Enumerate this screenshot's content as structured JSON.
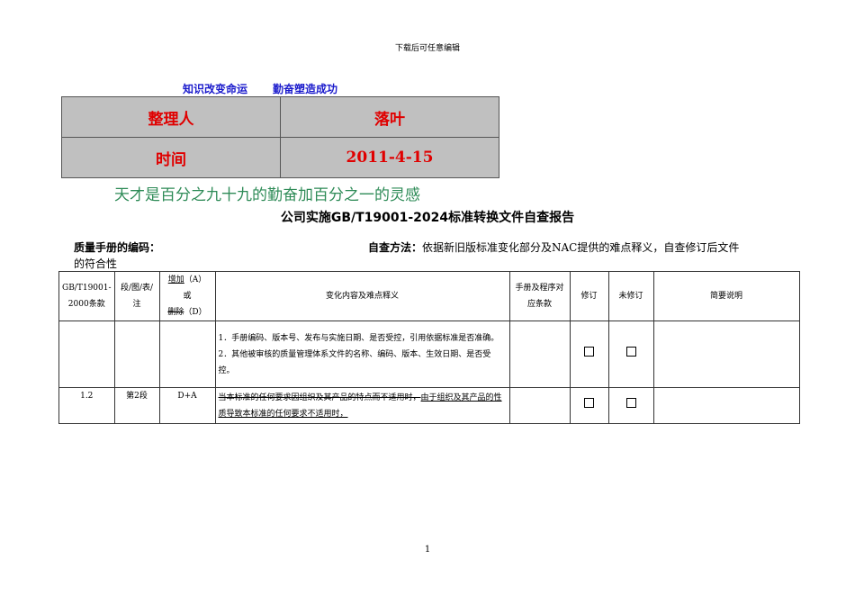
{
  "header": "下载后可任意编辑",
  "motto": [
    "知识改变命运",
    "勤奋塑造成功"
  ],
  "info": [
    {
      "label": "整理人",
      "value": "落叶"
    },
    {
      "label": "时间",
      "value": "2011-4-15"
    }
  ],
  "quote": "天才是百分之九十九的勤奋加百分之一的灵感",
  "title": "公司实施GB/T19001-2024标准转换文件自查报告",
  "code_label": "质量手册的编码：",
  "method_label": "自查方法：",
  "method_text": "依据新旧版标准变化部分及NAC提供的难点释义，自查修订后文件",
  "method_tail": "的符合性",
  "table": {
    "headers": {
      "clause": "GB/T19001-2000条款",
      "para": "段/图/表/注",
      "add": "增加",
      "add_code": "（A）",
      "or": "或",
      "del": "删除",
      "del_code": "（D）",
      "content": "变化内容及难点释义",
      "manual": "手册及程序对应条款",
      "revised": "修订",
      "unrevised": "未修订",
      "note": "简要说明"
    },
    "rows": [
      {
        "clause": "",
        "para": "",
        "ad": "",
        "lines": [
          "1．手册编码、版本号、发布与实施日期、是否受控，引用依据标准是否准确。",
          "2．其他被审核的质量管理体系文件的名称、编码、版本、生效日期、是否受控。"
        ]
      },
      {
        "clause": "1.2",
        "para": "第2段",
        "ad": "D+A",
        "deleted": "当本标准的任何要求因组织及其产品的特点而不适用时，",
        "added": "由于组织及其产品的性质导致本标准的任何要求不适用时，"
      }
    ]
  },
  "page_number": "1"
}
